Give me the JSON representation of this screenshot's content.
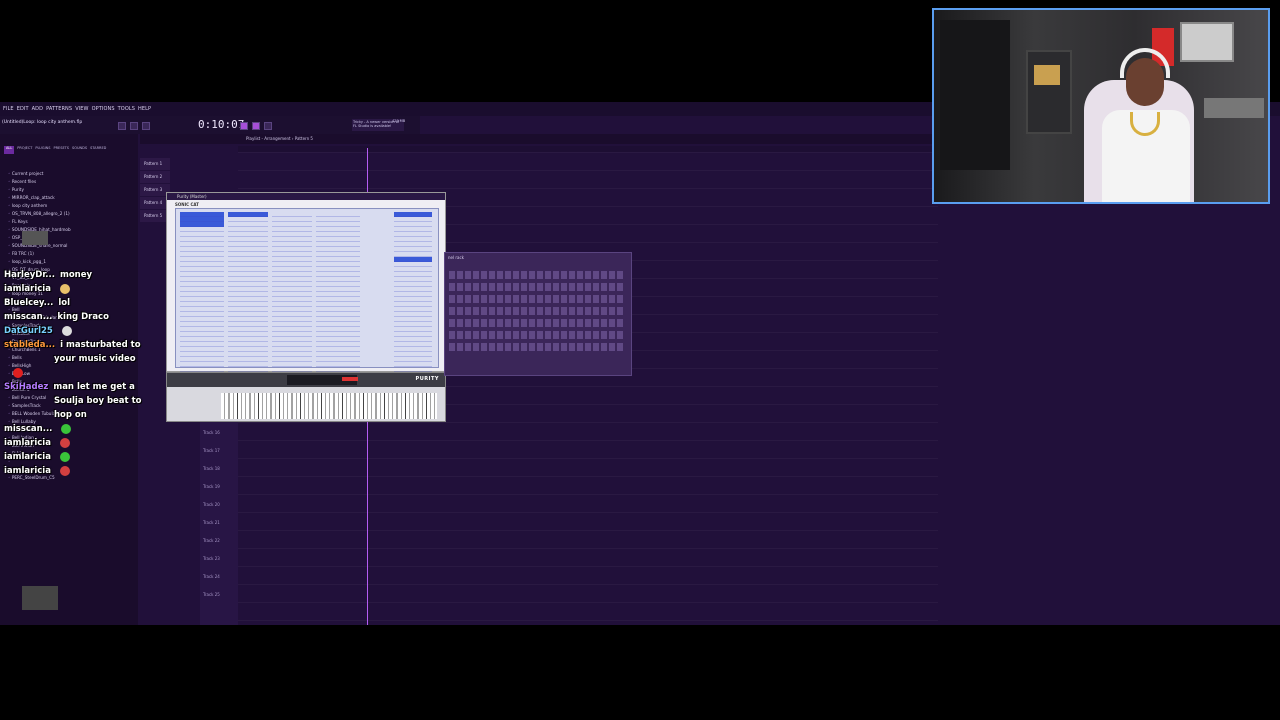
{
  "menu": [
    "FILE",
    "EDIT",
    "ADD",
    "PATTERNS",
    "VIEW",
    "OPTIONS",
    "TOOLS",
    "HELP"
  ],
  "toolbar": {
    "time": "0:10:07",
    "project_title": "(Untitled)Loop: loop city anthem.flp",
    "news": "Tricky - A newer version of FL Studio is available!",
    "cpu": "429 MB",
    "pattern_label": "Pattern 5"
  },
  "browser": {
    "tabs": [
      "ALL",
      "PROJECT",
      "PLUGINS",
      "PRESETS",
      "SOUNDS",
      "STARRED"
    ],
    "header": "Current project",
    "recent_label": "Recent files",
    "files": [
      "Current project",
      "Recent files",
      "Purity",
      "MIRROR_clap_attack",
      "loop city anthem",
      "OS_TRVN_808_allegro_2 (1)",
      "FL Keys",
      "SOUNDSIDE_hihat_hardmob",
      "OSP_Ayr",
      "SOUNDSIDE_snare_normal",
      "FB TRC (1)",
      "loop_kick_pgg_1",
      "OS_DT_drum_loop",
      "VT_BB_2",
      "Roar mix",
      "loop money 11",
      "Bell",
      "Bell",
      "BELL Wooden Tubular",
      "SamplesTrack",
      "SMStack",
      "DrumsetTrack",
      "ChurchBells 1",
      "Bells",
      "BellsHigh",
      "BellsLow",
      "Bells",
      "Bellish 3",
      "Bell Pure Crystal",
      "SamplesTrack",
      "BELL Wooden Tubular 05",
      "Bell Lullaby",
      "Bell Lullaby",
      "Bell Indian",
      "Bell Indian",
      "FL13",
      "",
      "all mansion new",
      "PERC_SteelDrum_C5"
    ]
  },
  "playlist": {
    "title": "Playlist - Arrangement › Pattern 5",
    "patterns": [
      "Pattern 1",
      "Pattern 2",
      "Pattern 3",
      "Pattern 4",
      "Pattern 5"
    ],
    "tracks": [
      "Track 16",
      "Track 17",
      "Track 18",
      "Track 19",
      "Track 20",
      "Track 21",
      "Track 22",
      "Track 23",
      "Track 24",
      "Track 25"
    ]
  },
  "sonic_cat": {
    "window_title": "Purity (Master)",
    "brand": "SONIC CAT",
    "presets_title": "Presets"
  },
  "purity": {
    "brand": "PURITY"
  },
  "channel_rack": {
    "title": "nel rack"
  },
  "chat": [
    {
      "user": "HarleyDr...",
      "text": "money",
      "color": "#ffffff"
    },
    {
      "user": "iamlaricia",
      "text": "",
      "color": "#ffffff",
      "emote": "#e8c06a"
    },
    {
      "user": "Bluelcey...",
      "text": "lol",
      "color": "#ffffff"
    },
    {
      "user": "misscan...",
      "text": "king Draco",
      "color": "#ffffff"
    },
    {
      "user": "DatGurl25",
      "text": "",
      "color": "#7ad0ff",
      "emote": "#ddd"
    },
    {
      "user": "stableda...",
      "text": "i masturbated to",
      "text2": "your music video",
      "color": "#ff9a3c"
    },
    {
      "user": "",
      "text": "",
      "color": "#ffffff",
      "emote": "#e02020"
    },
    {
      "user": "SkiHadez",
      "text": "man let me get a",
      "text2": "Soulja boy beat to",
      "text3": "hop on",
      "color": "#b57bff"
    },
    {
      "user": "misscan...",
      "text": "",
      "color": "#ffffff",
      "emote": "#3ac43a"
    },
    {
      "user": "iamlaricia",
      "text": "",
      "color": "#ffffff",
      "emote": "#d24040"
    },
    {
      "user": "iamlaricia",
      "text": "",
      "color": "#ffffff",
      "emote": "#3ac43a"
    },
    {
      "user": "iamlaricia",
      "text": "",
      "color": "#ffffff",
      "emote": "#d24040"
    }
  ]
}
